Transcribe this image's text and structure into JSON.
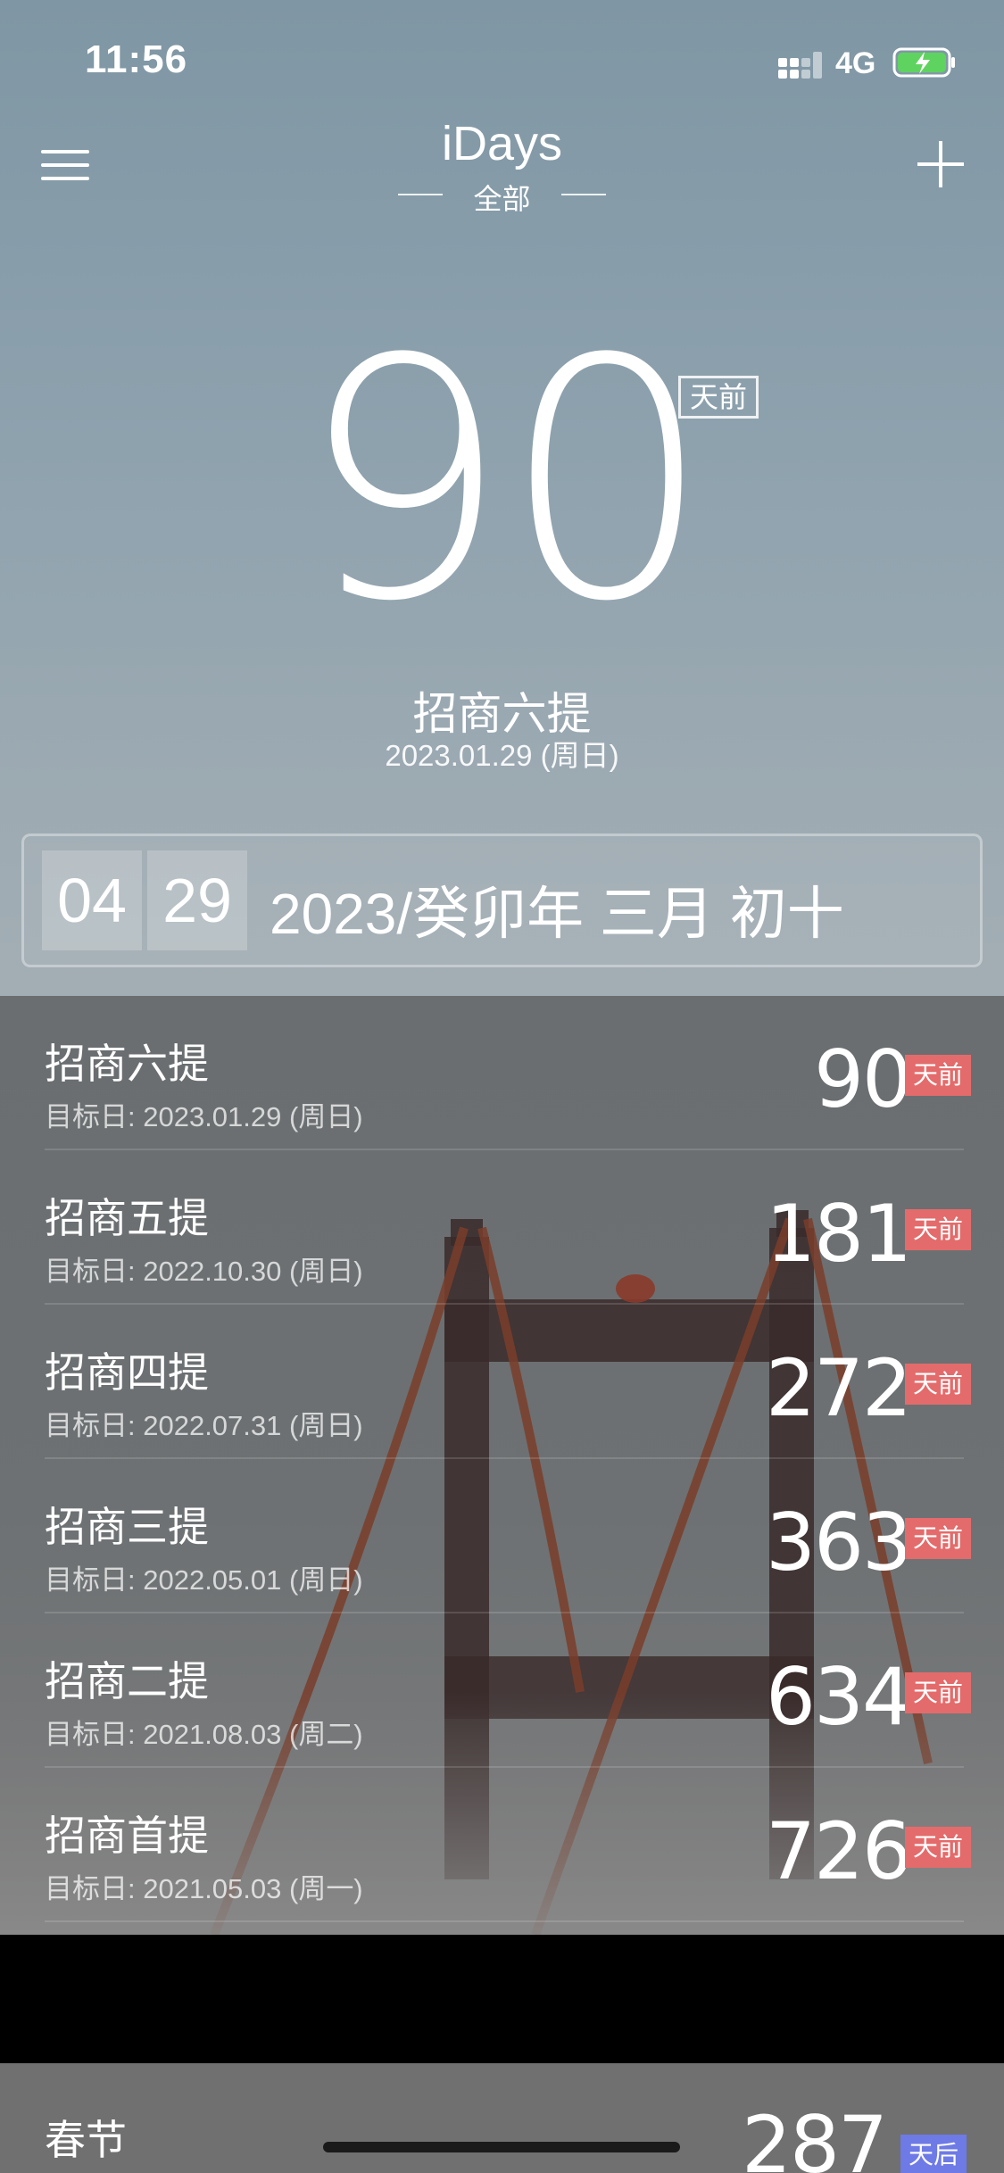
{
  "status_bar": {
    "time": "11:56",
    "network": "4G"
  },
  "nav": {
    "title": "iDays",
    "subtitle": "全部"
  },
  "hero": {
    "count": "90",
    "badge": "天前",
    "event_name": "招商六提",
    "event_date": "2023.01.29 (周日)"
  },
  "date_bar": {
    "month": "04",
    "day": "29",
    "lunar": "2023/癸卯年 三月 初十"
  },
  "events": [
    {
      "name": "招商六提",
      "date": "目标日: 2023.01.29 (周日)",
      "count": "90",
      "badge": "天前"
    },
    {
      "name": "招商五提",
      "date": "目标日: 2022.10.30 (周日)",
      "count": "181",
      "badge": "天前"
    },
    {
      "name": "招商四提",
      "date": "目标日: 2022.07.31 (周日)",
      "count": "272",
      "badge": "天前"
    },
    {
      "name": "招商三提",
      "date": "目标日: 2022.05.01 (周日)",
      "count": "363",
      "badge": "天前"
    },
    {
      "name": "招商二提",
      "date": "目标日: 2021.08.03 (周二)",
      "count": "634",
      "badge": "天前"
    },
    {
      "name": "招商首提",
      "date": "目标日: 2021.05.03 (周一)",
      "count": "726",
      "badge": "天前"
    }
  ],
  "next_section": {
    "name": "春节",
    "count": "287",
    "badge": "天后"
  },
  "colors": {
    "past_badge": "#e46b6b",
    "future_badge": "#6e7ae6"
  }
}
